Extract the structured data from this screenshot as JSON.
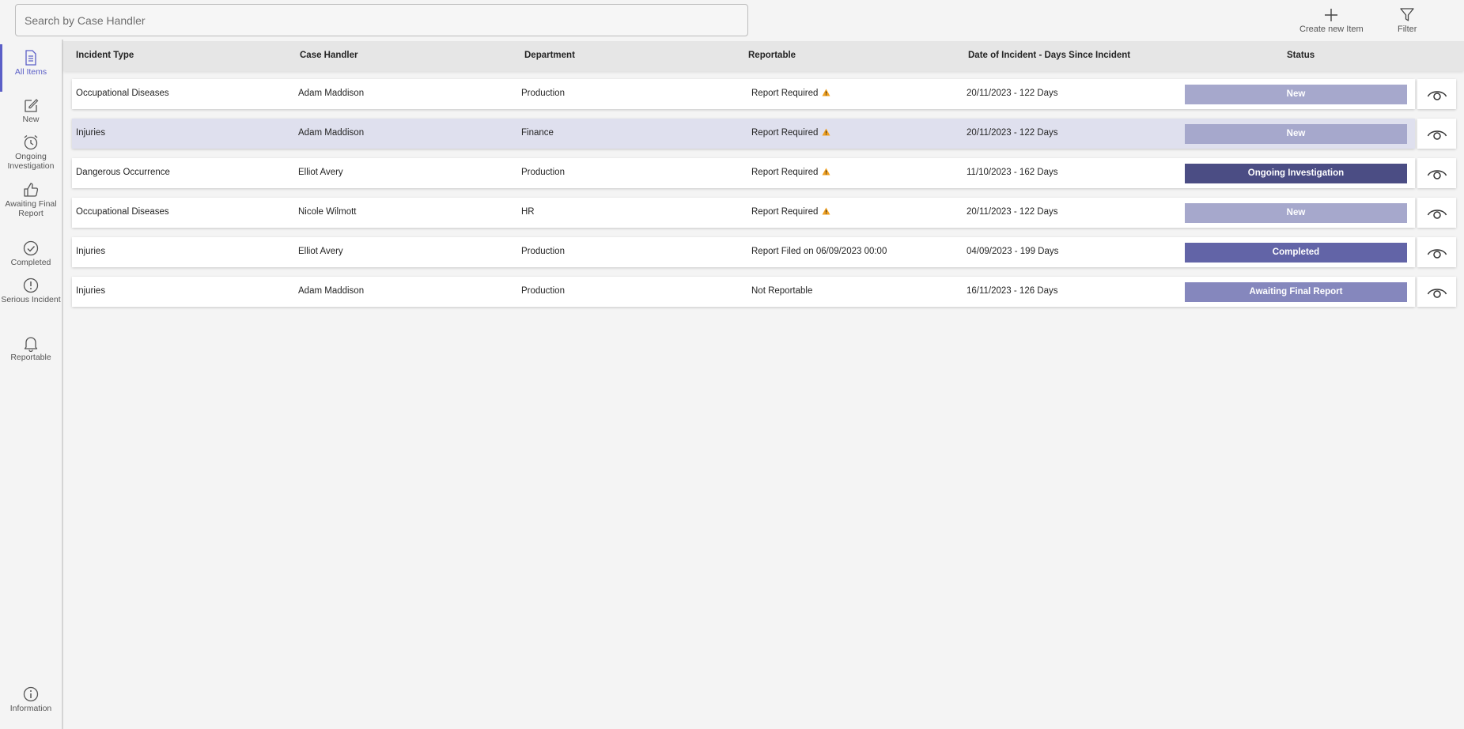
{
  "search": {
    "placeholder": "Search by Case Handler",
    "value": ""
  },
  "toolbar": {
    "create_label": "Create new Item",
    "filter_label": "Filter"
  },
  "sidebar": {
    "items": [
      {
        "label": "All Items",
        "icon": "document-icon"
      },
      {
        "label": "New",
        "icon": "compose-icon"
      },
      {
        "label": "Ongoing Investigation",
        "icon": "alarm-clock-icon"
      },
      {
        "label": "Awaiting Final Report",
        "icon": "thumbs-up-icon"
      },
      {
        "label": "Completed",
        "icon": "check-circle-icon"
      },
      {
        "label": "Serious Incident",
        "icon": "exclamation-circle-icon"
      },
      {
        "label": "Reportable",
        "icon": "bell-icon"
      },
      {
        "label": "Information",
        "icon": "info-icon"
      }
    ]
  },
  "table": {
    "headers": {
      "incident_type": "Incident Type",
      "case_handler": "Case Handler",
      "department": "Department",
      "reportable": "Reportable",
      "date": "Date of Incident - Days Since Incident",
      "status": "Status"
    },
    "rows": [
      {
        "incident_type": "Occupational Diseases",
        "case_handler": "Adam Maddison",
        "department": "Production",
        "reportable": "Report Required",
        "date": "20/11/2023 - 122 Days",
        "status": "New"
      },
      {
        "incident_type": "Injuries",
        "case_handler": "Adam Maddison",
        "department": "Finance",
        "reportable": "Report Required",
        "date": "20/11/2023 - 122 Days",
        "status": "New"
      },
      {
        "incident_type": "Dangerous Occurrence",
        "case_handler": "Elliot Avery",
        "department": "Production",
        "reportable": "Report Required",
        "date": "11/10/2023 - 162 Days",
        "status": "Ongoing Investigation"
      },
      {
        "incident_type": "Occupational Diseases",
        "case_handler": "Nicole Wilmott",
        "department": "HR",
        "reportable": "Report Required",
        "date": "20/11/2023 - 122 Days",
        "status": "New"
      },
      {
        "incident_type": "Injuries",
        "case_handler": "Elliot Avery",
        "department": "Production",
        "reportable": "Report Filed on 06/09/2023 00:00",
        "date": "04/09/2023 - 199 Days",
        "status": "Completed"
      },
      {
        "incident_type": "Injuries",
        "case_handler": "Adam Maddison",
        "department": "Production",
        "reportable": "Not Reportable",
        "date": "16/11/2023 - 126 Days",
        "status": "Awaiting Final Report"
      }
    ]
  },
  "colors": {
    "accent": "#5b5fc7",
    "status_new": "#a6a8cc",
    "status_ongoing": "#4b4d84",
    "status_completed": "#6264a7",
    "status_awaiting": "#8587bd",
    "warning": "#f0a020"
  }
}
